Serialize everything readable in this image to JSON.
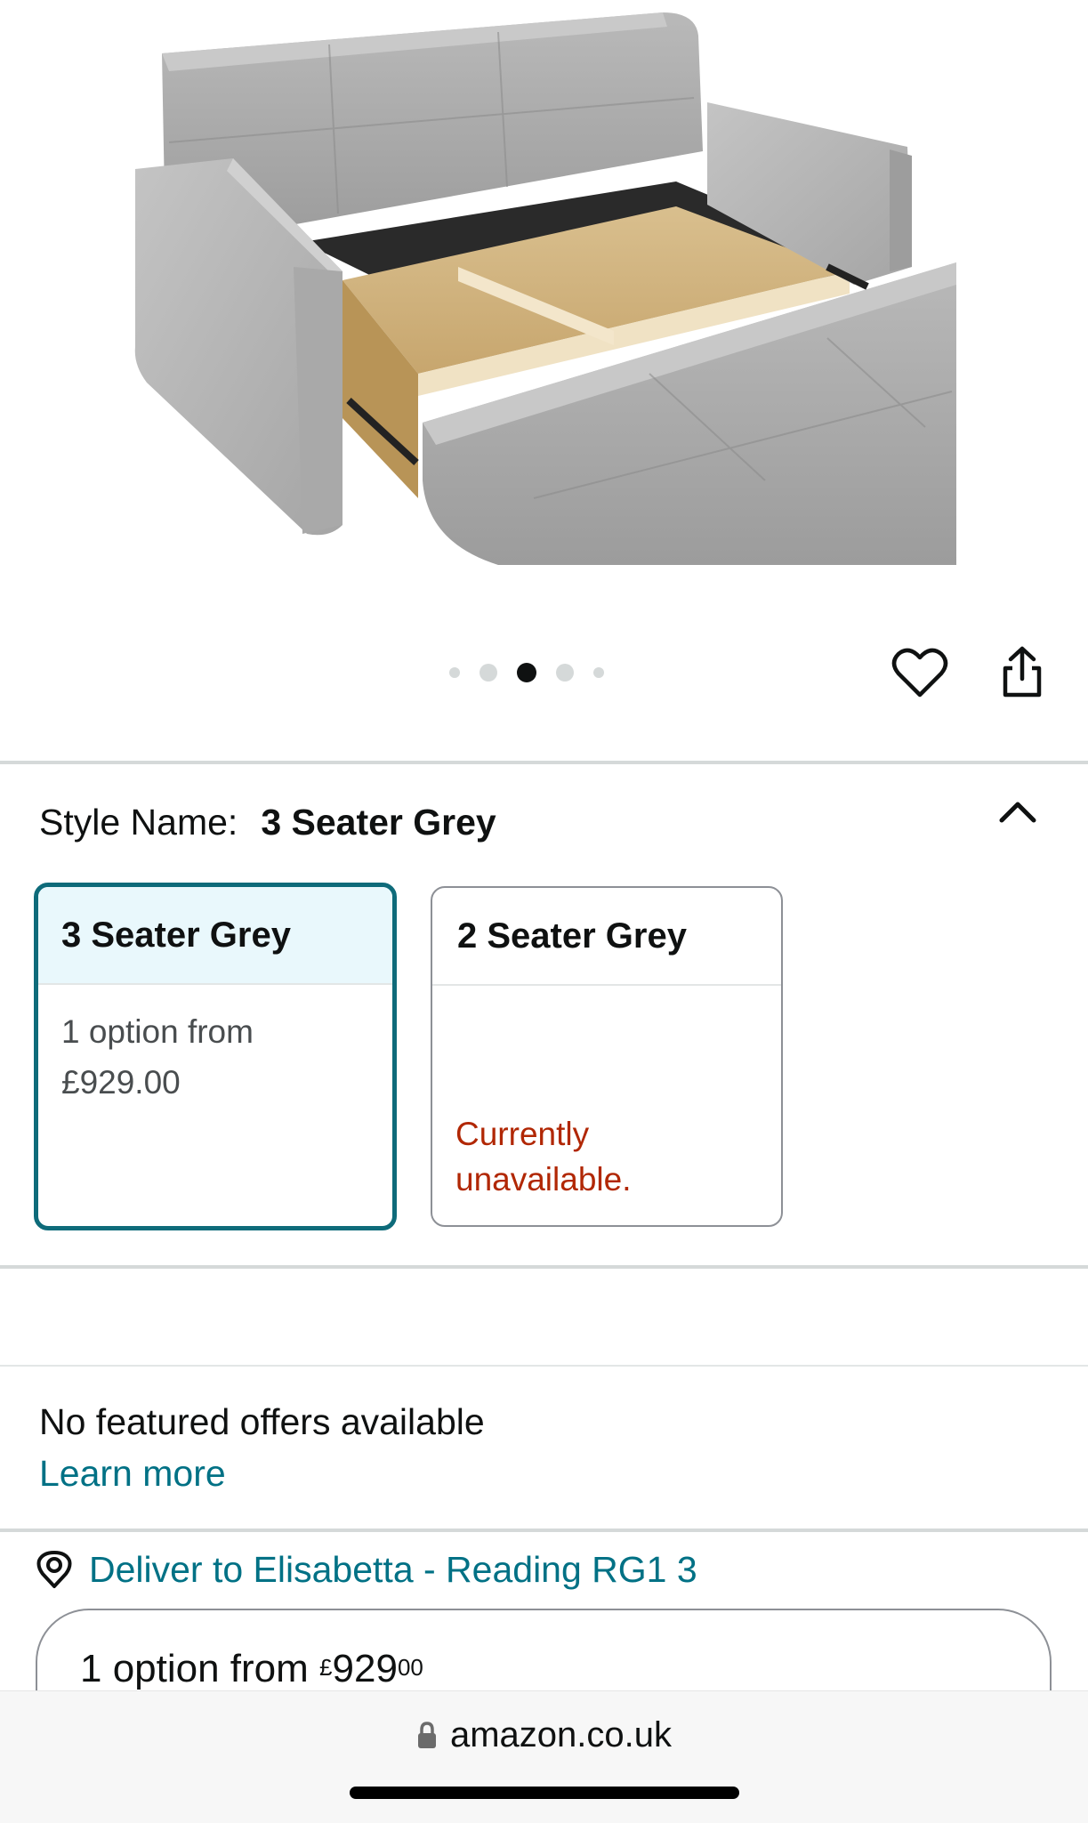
{
  "gallery": {
    "dots": 5,
    "active_dot": 3
  },
  "style": {
    "label": "Style Name:",
    "value": "3 Seater Grey"
  },
  "options": [
    {
      "title": "3 Seater Grey",
      "line1": "1 option from",
      "line2": "£929.00",
      "selected": true
    },
    {
      "title": "2 Seater Grey",
      "unavailable_line1": "Currently",
      "unavailable_line2": "unavailable.",
      "selected": false
    }
  ],
  "offers": {
    "no_offers": "No featured offers available",
    "learn_more": "Learn more"
  },
  "delivery": {
    "text": "Deliver to Elisabetta - Reading RG1 3"
  },
  "buy_box": {
    "prefix": "1 option from",
    "currency": "£",
    "whole": "929",
    "fraction": "00"
  },
  "browser": {
    "url": "amazon.co.uk"
  },
  "colors": {
    "link": "#007185",
    "selected_border": "#0e6b7a",
    "unavailable": "#b12704"
  }
}
